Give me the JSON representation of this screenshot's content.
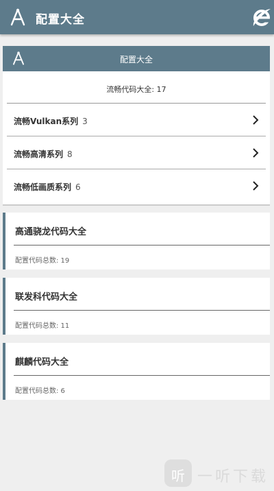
{
  "appbar": {
    "title": "配置大全",
    "logo_icon": "compass-logo-icon",
    "browser_icon": "ie-browser-icon"
  },
  "panel": {
    "title": "配置大全",
    "summary": "流畅代码大全: 17",
    "rows": [
      {
        "label": "流畅Vulkan系列",
        "count": "3"
      },
      {
        "label": "流畅高清系列",
        "count": "8"
      },
      {
        "label": "流畅低画质系列",
        "count": "6"
      }
    ]
  },
  "cards": [
    {
      "title": "高通骁龙代码大全",
      "meta": "配置代码总数: 19"
    },
    {
      "title": "联发科代码大全",
      "meta": "配置代码总数: 11"
    },
    {
      "title": "麒麟代码大全",
      "meta": "配置代码总数: 6"
    }
  ],
  "watermark": {
    "icon_text": "听",
    "text": "一听下载"
  },
  "colors": {
    "primary": "#5d7b8b",
    "background": "#efefef"
  }
}
